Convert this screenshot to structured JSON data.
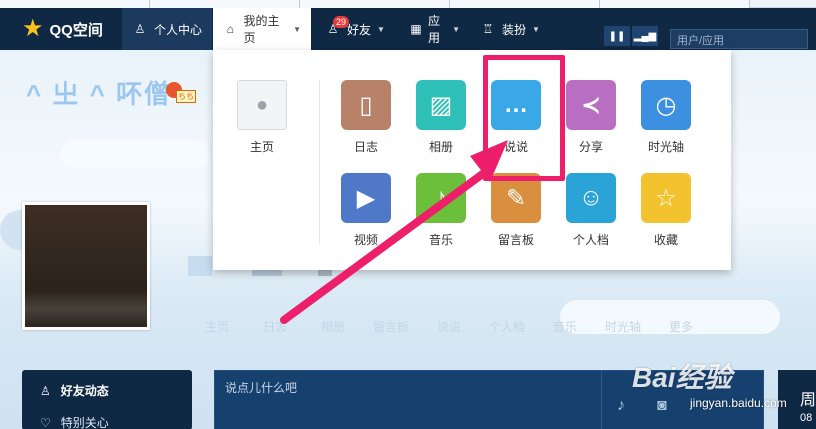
{
  "topbar": {
    "logo_text": "QQ空间",
    "nav": {
      "personal": "个人中心",
      "home": "我的主页",
      "friends": "好友",
      "friends_badge": "29",
      "apps": "应用",
      "dress": "装扮"
    },
    "search_placeholder": "用户/应用"
  },
  "profile": {
    "nickname": "^ 㞢 ^ 吥僧",
    "level_badge": "ちち",
    "tabs": [
      "主页",
      "日志",
      "相册",
      "留言板",
      "说说",
      "个人档",
      "音乐",
      "时光轴",
      "更多"
    ]
  },
  "dropdown": {
    "home_label": "主页",
    "apps": [
      {
        "label": "日志",
        "icon": "notebook-icon",
        "color": "#b8826a",
        "glyph": "▯"
      },
      {
        "label": "相册",
        "icon": "photo-icon",
        "color": "#2ec0b8",
        "glyph": "▨"
      },
      {
        "label": "说说",
        "icon": "chat-bubble-icon",
        "color": "#3aa7e6",
        "glyph": "…"
      },
      {
        "label": "分享",
        "icon": "share-icon",
        "color": "#b86fc2",
        "glyph": "≺"
      },
      {
        "label": "时光轴",
        "icon": "timeline-icon",
        "color": "#3d8fe0",
        "glyph": "◷"
      },
      {
        "label": "视频",
        "icon": "video-icon",
        "color": "#4f78c8",
        "glyph": "▶"
      },
      {
        "label": "音乐",
        "icon": "music-icon",
        "color": "#6cbf3a",
        "glyph": "♪"
      },
      {
        "label": "留言板",
        "icon": "message-board-icon",
        "color": "#d98f3e",
        "glyph": "✎"
      },
      {
        "label": "个人档",
        "icon": "profile-card-icon",
        "color": "#2aa3d6",
        "glyph": "☺"
      },
      {
        "label": "收藏",
        "icon": "star-icon",
        "color": "#f2c32e",
        "glyph": "☆"
      }
    ]
  },
  "sidebar": {
    "items": [
      "好友动态",
      "特别关心"
    ]
  },
  "post": {
    "placeholder": "说点儿什么吧"
  },
  "rightbox": {
    "title": "周",
    "sub": "08"
  },
  "watermark": {
    "brand": "Bai经验",
    "url": "jingyan.baidu.com"
  },
  "colors": {
    "topbar": "#0f2844",
    "highlight": "#ee1f6a",
    "accent_logo": "#ffc21a"
  }
}
